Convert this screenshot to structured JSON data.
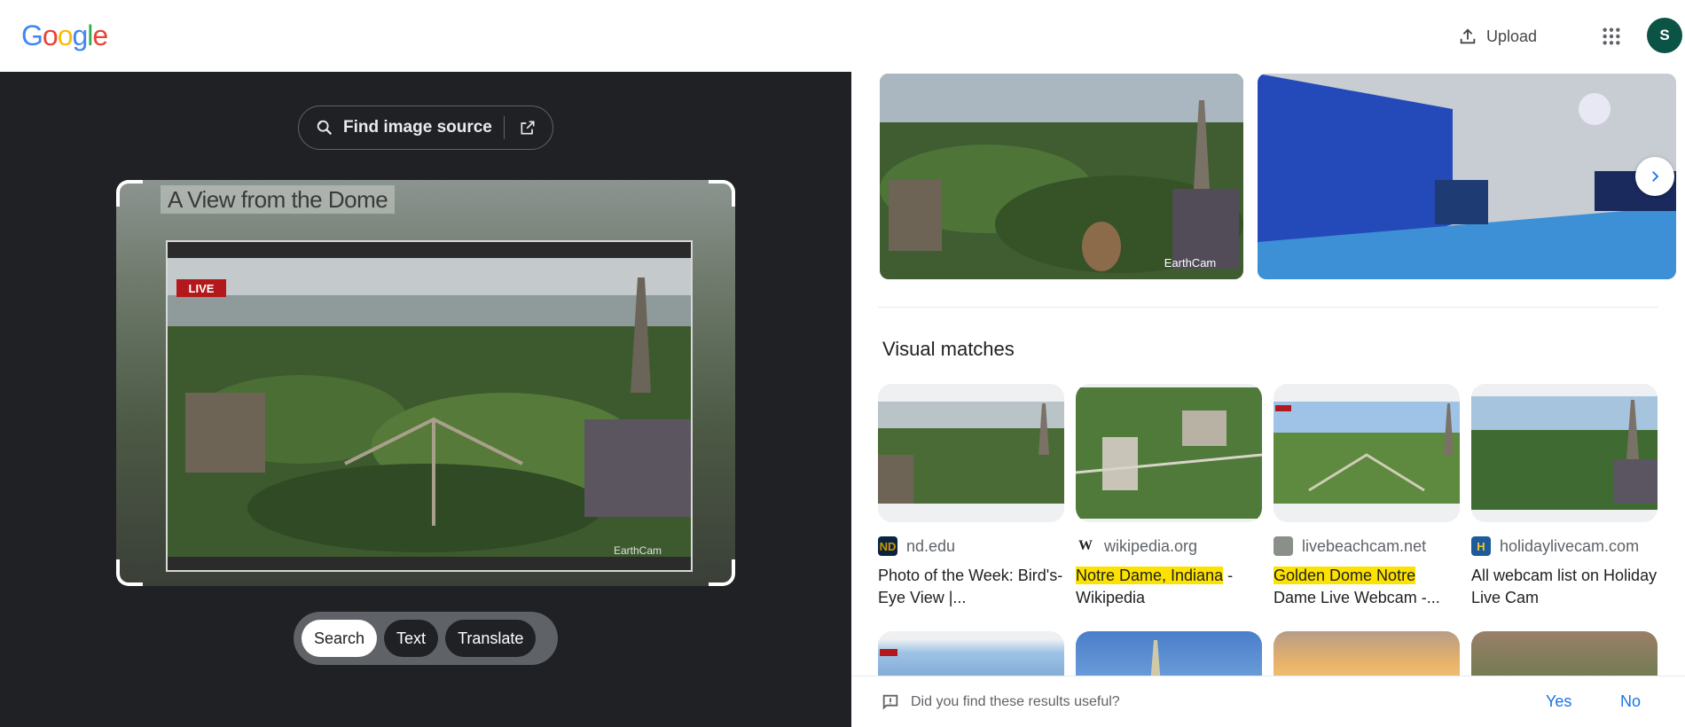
{
  "header": {
    "logo_letters": [
      "G",
      "o",
      "o",
      "g",
      "l",
      "e"
    ],
    "logo_colors": [
      "#4285F4",
      "#EA4335",
      "#FBBC05",
      "#4285F4",
      "#34A853",
      "#EA4335"
    ],
    "upload_label": "Upload",
    "avatar_initial": "S",
    "avatar_color": "#0b5345"
  },
  "left": {
    "find_source_label": "Find image source",
    "image_title_overlay": "A View from the Dome",
    "live_badge": "LIVE",
    "watermark": "EarthCam",
    "modes": [
      "Search",
      "Text",
      "Translate"
    ],
    "active_mode": "Search"
  },
  "right": {
    "top_watermark": "EarthCam",
    "section_title": "Visual matches",
    "cards": [
      {
        "site": "nd.edu",
        "favicon": "ND",
        "favicon_bg": "#0c2340",
        "favicon_color": "#c99700",
        "title_plain": "Photo of the Week: Bird's-Eye View |...",
        "title_hl": "",
        "title_rest": ""
      },
      {
        "site": "wikipedia.org",
        "favicon": "W",
        "favicon_bg": "#ffffff",
        "favicon_color": "#202124",
        "title_plain": "",
        "title_hl": "Notre Dame, Indiana",
        "title_rest": " - Wikipedia"
      },
      {
        "site": "livebeachcam.net",
        "favicon": "",
        "favicon_bg": "#8a8f8a",
        "favicon_color": "#ffffff",
        "title_plain": "",
        "title_hl": "Golden Dome Notre",
        "title_rest": " Dame Live Webcam -..."
      },
      {
        "site": "holidaylivecam.com",
        "favicon": "H",
        "favicon_bg": "#1d5b9a",
        "favicon_color": "#f4c430",
        "title_plain": "All webcam list on Holiday Live Cam",
        "title_hl": "",
        "title_rest": ""
      }
    ],
    "feedback_question": "Did you find these results useful?",
    "feedback_yes": "Yes",
    "feedback_no": "No"
  }
}
